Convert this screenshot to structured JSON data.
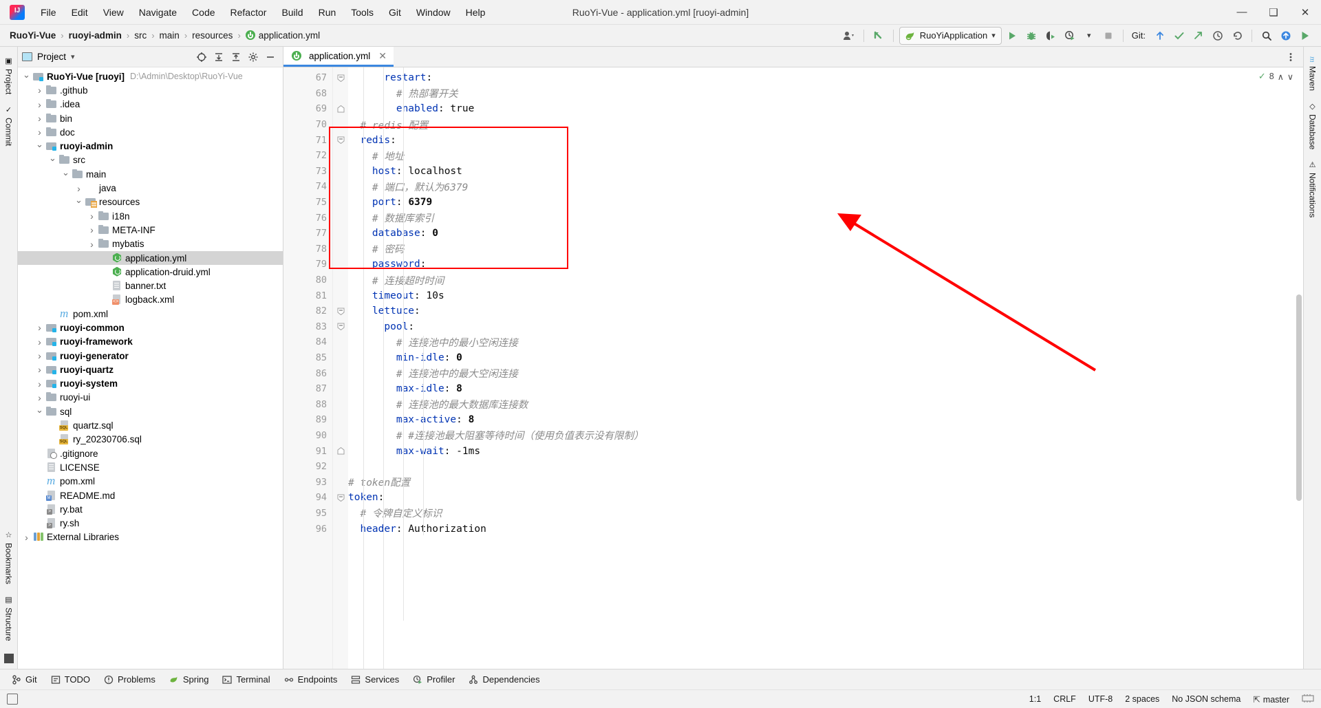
{
  "window": {
    "title": "RuoYi-Vue - application.yml [ruoyi-admin]",
    "minimize": "—",
    "maximize": "❑",
    "close": "✕"
  },
  "menubar": [
    "File",
    "Edit",
    "View",
    "Navigate",
    "Code",
    "Refactor",
    "Build",
    "Run",
    "Tools",
    "Git",
    "Window",
    "Help"
  ],
  "breadcrumb": {
    "items": [
      {
        "label": "RuoYi-Vue",
        "bold": true,
        "icon": ""
      },
      {
        "label": "ruoyi-admin",
        "bold": true,
        "icon": ""
      },
      {
        "label": "src",
        "bold": false,
        "icon": ""
      },
      {
        "label": "main",
        "bold": false,
        "icon": ""
      },
      {
        "label": "resources",
        "bold": false,
        "icon": ""
      },
      {
        "label": "application.yml",
        "bold": false,
        "icon": "spring-yml-icon"
      }
    ],
    "separator": "›"
  },
  "toolbar": {
    "account_icon": "user-account-icon",
    "updates_icon": "updates-arrow-icon",
    "run_config": "RuoYiApplication",
    "run_config_icon": "spring-boot-icon",
    "dropdown_caret": "▾",
    "run_icon": "run-icon",
    "debug_icon": "debug-icon",
    "run_coverage_icon": "run-with-coverage-icon",
    "profiler_icon": "profiler-icon",
    "more_caret": "▾",
    "stop_icon": "stop-icon",
    "git_label": "Git:",
    "git_update_icon": "git-update-icon",
    "git_commit_icon": "git-commit-icon",
    "git_push_icon": "git-push-icon",
    "history_icon": "history-icon",
    "rollback_icon": "rollback-icon",
    "search_icon": "search-everywhere-icon",
    "ide_update_icon": "ide-update-icon",
    "run_green_icon": "run-green-icon"
  },
  "left_strip": [
    {
      "label": "Project",
      "icon": "project-icon"
    },
    {
      "label": "Commit",
      "icon": "commit-icon"
    }
  ],
  "left_strip_bottom": [
    {
      "label": "Bookmarks",
      "icon": "bookmarks-icon"
    },
    {
      "label": "Structure",
      "icon": "structure-icon"
    }
  ],
  "right_strip": [
    {
      "label": "m",
      "icon": "maven-icon"
    },
    {
      "label": "Maven",
      "icon": "maven-icon"
    },
    {
      "label": "Database",
      "icon": "database-icon"
    },
    {
      "label": "Notifications",
      "icon": "notifications-icon"
    }
  ],
  "project_panel": {
    "title": "Project",
    "title_caret": "▾",
    "actions": [
      "select-opened-file-icon",
      "expand-all-icon",
      "collapse-all-icon",
      "settings-gear-icon",
      "hide-icon"
    ],
    "tree": [
      {
        "depth": 0,
        "arrow": "open",
        "icon": "ic-module",
        "label": "RuoYi-Vue [ruoyi]",
        "bold": true,
        "path": "D:\\Admin\\Desktop\\RuoYi-Vue"
      },
      {
        "depth": 1,
        "arrow": "closed",
        "icon": "ic-folder",
        "label": ".github",
        "bold": false,
        "path": ""
      },
      {
        "depth": 1,
        "arrow": "closed",
        "icon": "ic-folder",
        "label": ".idea",
        "bold": false,
        "path": ""
      },
      {
        "depth": 1,
        "arrow": "closed",
        "icon": "ic-folder",
        "label": "bin",
        "bold": false,
        "path": ""
      },
      {
        "depth": 1,
        "arrow": "closed",
        "icon": "ic-folder",
        "label": "doc",
        "bold": false,
        "path": ""
      },
      {
        "depth": 1,
        "arrow": "open",
        "icon": "ic-module",
        "label": "ruoyi-admin",
        "bold": true,
        "path": ""
      },
      {
        "depth": 2,
        "arrow": "open",
        "icon": "ic-folder",
        "label": "src",
        "bold": false,
        "path": ""
      },
      {
        "depth": 3,
        "arrow": "open",
        "icon": "ic-folder",
        "label": "main",
        "bold": false,
        "path": ""
      },
      {
        "depth": 4,
        "arrow": "closed",
        "icon": "ic-folder-src",
        "label": "java",
        "bold": false,
        "path": ""
      },
      {
        "depth": 4,
        "arrow": "open",
        "icon": "ic-res",
        "label": "resources",
        "bold": false,
        "path": ""
      },
      {
        "depth": 5,
        "arrow": "closed",
        "icon": "ic-folder",
        "label": "i18n",
        "bold": false,
        "path": ""
      },
      {
        "depth": 5,
        "arrow": "closed",
        "icon": "ic-folder",
        "label": "META-INF",
        "bold": false,
        "path": ""
      },
      {
        "depth": 5,
        "arrow": "closed",
        "icon": "ic-folder",
        "label": "mybatis",
        "bold": false,
        "path": ""
      },
      {
        "depth": 6,
        "arrow": "none",
        "icon": "ic-spring",
        "label": "application.yml",
        "bold": false,
        "path": "",
        "selected": true
      },
      {
        "depth": 6,
        "arrow": "none",
        "icon": "ic-spring",
        "label": "application-druid.yml",
        "bold": false,
        "path": ""
      },
      {
        "depth": 6,
        "arrow": "none",
        "icon": "ic-file",
        "label": "banner.txt",
        "bold": false,
        "path": ""
      },
      {
        "depth": 6,
        "arrow": "none",
        "icon": "ic-xml",
        "label": "logback.xml",
        "bold": false,
        "path": ""
      },
      {
        "depth": 2,
        "arrow": "none",
        "icon": "ic-maven",
        "label": "pom.xml",
        "bold": false,
        "path": ""
      },
      {
        "depth": 1,
        "arrow": "closed",
        "icon": "ic-module",
        "label": "ruoyi-common",
        "bold": true,
        "path": ""
      },
      {
        "depth": 1,
        "arrow": "closed",
        "icon": "ic-module",
        "label": "ruoyi-framework",
        "bold": true,
        "path": ""
      },
      {
        "depth": 1,
        "arrow": "closed",
        "icon": "ic-module",
        "label": "ruoyi-generator",
        "bold": true,
        "path": ""
      },
      {
        "depth": 1,
        "arrow": "closed",
        "icon": "ic-module",
        "label": "ruoyi-quartz",
        "bold": true,
        "path": ""
      },
      {
        "depth": 1,
        "arrow": "closed",
        "icon": "ic-module",
        "label": "ruoyi-system",
        "bold": true,
        "path": ""
      },
      {
        "depth": 1,
        "arrow": "closed",
        "icon": "ic-folder",
        "label": "ruoyi-ui",
        "bold": false,
        "path": ""
      },
      {
        "depth": 1,
        "arrow": "open",
        "icon": "ic-folder",
        "label": "sql",
        "bold": false,
        "path": ""
      },
      {
        "depth": 2,
        "arrow": "none",
        "icon": "ic-sql",
        "label": "quartz.sql",
        "bold": false,
        "path": ""
      },
      {
        "depth": 2,
        "arrow": "none",
        "icon": "ic-sql",
        "label": "ry_20230706.sql",
        "bold": false,
        "path": ""
      },
      {
        "depth": 1,
        "arrow": "none",
        "icon": "ic-git",
        "label": ".gitignore",
        "bold": false,
        "path": ""
      },
      {
        "depth": 1,
        "arrow": "none",
        "icon": "ic-file",
        "label": "LICENSE",
        "bold": false,
        "path": ""
      },
      {
        "depth": 1,
        "arrow": "none",
        "icon": "ic-maven",
        "label": "pom.xml",
        "bold": false,
        "path": ""
      },
      {
        "depth": 1,
        "arrow": "none",
        "icon": "ic-md",
        "label": "README.md",
        "bold": false,
        "path": ""
      },
      {
        "depth": 1,
        "arrow": "none",
        "icon": "ic-bat",
        "label": "ry.bat",
        "bold": false,
        "path": ""
      },
      {
        "depth": 1,
        "arrow": "none",
        "icon": "ic-bat",
        "label": "ry.sh",
        "bold": false,
        "path": ""
      },
      {
        "depth": 0,
        "arrow": "closed",
        "icon": "ic-lib",
        "label": "External Libraries",
        "bold": false,
        "path": ""
      }
    ]
  },
  "editor": {
    "tab": {
      "label": "application.yml",
      "icon": "spring-yml-icon",
      "close": "✕"
    },
    "inspections": {
      "count": "8",
      "ok_icon": "inspection-ok-icon",
      "up_caret": "∧",
      "down_caret": "∨"
    },
    "first_line_number": 67,
    "lines": [
      {
        "n": 67,
        "fold": "minus",
        "indent": 0,
        "tokens": [
          {
            "t": "      ",
            "c": ""
          },
          {
            "t": "restart",
            "c": "k-key"
          },
          {
            "t": ":",
            "c": "k-val"
          }
        ]
      },
      {
        "n": 68,
        "fold": "",
        "indent": 0,
        "tokens": [
          {
            "t": "        # 热部署开关",
            "c": "k-com"
          }
        ]
      },
      {
        "n": 69,
        "fold": "end",
        "indent": 0,
        "tokens": [
          {
            "t": "        ",
            "c": ""
          },
          {
            "t": "enabled",
            "c": "k-key"
          },
          {
            "t": ": ",
            "c": "k-val"
          },
          {
            "t": "true",
            "c": "k-val"
          }
        ]
      },
      {
        "n": 70,
        "fold": "",
        "indent": 0,
        "tokens": [
          {
            "t": "  # redis 配置",
            "c": "k-com"
          }
        ]
      },
      {
        "n": 71,
        "fold": "minus",
        "indent": 0,
        "tokens": [
          {
            "t": "  ",
            "c": ""
          },
          {
            "t": "redis",
            "c": "k-key"
          },
          {
            "t": ":",
            "c": "k-val"
          }
        ]
      },
      {
        "n": 72,
        "fold": "",
        "indent": 0,
        "tokens": [
          {
            "t": "    # 地址",
            "c": "k-com"
          }
        ]
      },
      {
        "n": 73,
        "fold": "",
        "indent": 0,
        "tokens": [
          {
            "t": "    ",
            "c": ""
          },
          {
            "t": "host",
            "c": "k-key"
          },
          {
            "t": ": ",
            "c": "k-val"
          },
          {
            "t": "localhost",
            "c": "k-val"
          }
        ]
      },
      {
        "n": 74,
        "fold": "",
        "indent": 0,
        "tokens": [
          {
            "t": "    # 端口，默认为6379",
            "c": "k-com"
          }
        ]
      },
      {
        "n": 75,
        "fold": "",
        "indent": 0,
        "tokens": [
          {
            "t": "    ",
            "c": ""
          },
          {
            "t": "port",
            "c": "k-key"
          },
          {
            "t": ": ",
            "c": "k-val"
          },
          {
            "t": "6379",
            "c": "k-num"
          }
        ]
      },
      {
        "n": 76,
        "fold": "",
        "indent": 0,
        "tokens": [
          {
            "t": "    # 数据库索引",
            "c": "k-com"
          }
        ]
      },
      {
        "n": 77,
        "fold": "",
        "indent": 0,
        "tokens": [
          {
            "t": "    ",
            "c": ""
          },
          {
            "t": "database",
            "c": "k-key"
          },
          {
            "t": ": ",
            "c": "k-val"
          },
          {
            "t": "0",
            "c": "k-num"
          }
        ]
      },
      {
        "n": 78,
        "fold": "",
        "indent": 0,
        "tokens": [
          {
            "t": "    # 密码",
            "c": "k-com"
          }
        ]
      },
      {
        "n": 79,
        "fold": "",
        "indent": 0,
        "tokens": [
          {
            "t": "    ",
            "c": ""
          },
          {
            "t": "password",
            "c": "k-key"
          },
          {
            "t": ":",
            "c": "k-val"
          }
        ]
      },
      {
        "n": 80,
        "fold": "",
        "indent": 0,
        "tokens": [
          {
            "t": "    # 连接超时时间",
            "c": "k-com"
          }
        ]
      },
      {
        "n": 81,
        "fold": "",
        "indent": 0,
        "tokens": [
          {
            "t": "    ",
            "c": ""
          },
          {
            "t": "timeout",
            "c": "k-key"
          },
          {
            "t": ": ",
            "c": "k-val"
          },
          {
            "t": "10s",
            "c": "k-val"
          }
        ]
      },
      {
        "n": 82,
        "fold": "minus",
        "indent": 0,
        "tokens": [
          {
            "t": "    ",
            "c": ""
          },
          {
            "t": "lettuce",
            "c": "k-key"
          },
          {
            "t": ":",
            "c": "k-val"
          }
        ]
      },
      {
        "n": 83,
        "fold": "minus",
        "indent": 0,
        "tokens": [
          {
            "t": "      ",
            "c": ""
          },
          {
            "t": "pool",
            "c": "k-key"
          },
          {
            "t": ":",
            "c": "k-val"
          }
        ]
      },
      {
        "n": 84,
        "fold": "",
        "indent": 0,
        "tokens": [
          {
            "t": "        # 连接池中的最小空闲连接",
            "c": "k-com"
          }
        ]
      },
      {
        "n": 85,
        "fold": "",
        "indent": 0,
        "tokens": [
          {
            "t": "        ",
            "c": ""
          },
          {
            "t": "min-idle",
            "c": "k-key"
          },
          {
            "t": ": ",
            "c": "k-val"
          },
          {
            "t": "0",
            "c": "k-num"
          }
        ]
      },
      {
        "n": 86,
        "fold": "",
        "indent": 0,
        "tokens": [
          {
            "t": "        # 连接池中的最大空闲连接",
            "c": "k-com"
          }
        ]
      },
      {
        "n": 87,
        "fold": "",
        "indent": 0,
        "tokens": [
          {
            "t": "        ",
            "c": ""
          },
          {
            "t": "max-idle",
            "c": "k-key"
          },
          {
            "t": ": ",
            "c": "k-val"
          },
          {
            "t": "8",
            "c": "k-num"
          }
        ]
      },
      {
        "n": 88,
        "fold": "",
        "indent": 0,
        "tokens": [
          {
            "t": "        # 连接池的最大数据库连接数",
            "c": "k-com"
          }
        ]
      },
      {
        "n": 89,
        "fold": "",
        "indent": 0,
        "tokens": [
          {
            "t": "        ",
            "c": ""
          },
          {
            "t": "max-active",
            "c": "k-key"
          },
          {
            "t": ": ",
            "c": "k-val"
          },
          {
            "t": "8",
            "c": "k-num"
          }
        ]
      },
      {
        "n": 90,
        "fold": "",
        "indent": 0,
        "tokens": [
          {
            "t": "        # #连接池最大阻塞等待时间（使用负值表示没有限制）",
            "c": "k-com"
          }
        ]
      },
      {
        "n": 91,
        "fold": "end",
        "indent": 0,
        "tokens": [
          {
            "t": "        ",
            "c": ""
          },
          {
            "t": "max-wait",
            "c": "k-key"
          },
          {
            "t": ": ",
            "c": "k-val"
          },
          {
            "t": "-1ms",
            "c": "k-val"
          }
        ]
      },
      {
        "n": 92,
        "fold": "",
        "indent": 0,
        "tokens": []
      },
      {
        "n": 93,
        "fold": "",
        "indent": 0,
        "tokens": [
          {
            "t": "# token配置",
            "c": "k-com"
          }
        ]
      },
      {
        "n": 94,
        "fold": "minus",
        "indent": 0,
        "tokens": [
          {
            "t": "token",
            "c": "k-key"
          },
          {
            "t": ":",
            "c": "k-val"
          }
        ]
      },
      {
        "n": 95,
        "fold": "",
        "indent": 0,
        "tokens": [
          {
            "t": "  # 令牌自定义标识",
            "c": "k-com"
          }
        ]
      },
      {
        "n": 96,
        "fold": "",
        "indent": 0,
        "tokens": [
          {
            "t": "  ",
            "c": ""
          },
          {
            "t": "header",
            "c": "k-key"
          },
          {
            "t": ": ",
            "c": "k-val"
          },
          {
            "t": "Authorization",
            "c": "k-val"
          }
        ]
      }
    ],
    "annotation": {
      "box_color": "#ff0000",
      "arrow_color": "#ff0000",
      "box_label": "redis-config-highlight"
    }
  },
  "bottom_toolwindows": [
    {
      "label": "Git",
      "icon": "git-icon"
    },
    {
      "label": "TODO",
      "icon": "todo-icon"
    },
    {
      "label": "Problems",
      "icon": "problems-icon"
    },
    {
      "label": "Spring",
      "icon": "spring-icon"
    },
    {
      "label": "Terminal",
      "icon": "terminal-icon"
    },
    {
      "label": "Endpoints",
      "icon": "endpoints-icon"
    },
    {
      "label": "Services",
      "icon": "services-icon"
    },
    {
      "label": "Profiler",
      "icon": "profiler-icon"
    },
    {
      "label": "Dependencies",
      "icon": "dependencies-icon"
    }
  ],
  "statusbar": {
    "left_icon": "event-log-icon",
    "caret": "1:1",
    "line_separator": "CRLF",
    "encoding": "UTF-8",
    "indent": "2 spaces",
    "schema": "No JSON schema",
    "branch": "master",
    "branch_icon": "git-branch-icon",
    "memory_icon": "memory-indicator"
  }
}
